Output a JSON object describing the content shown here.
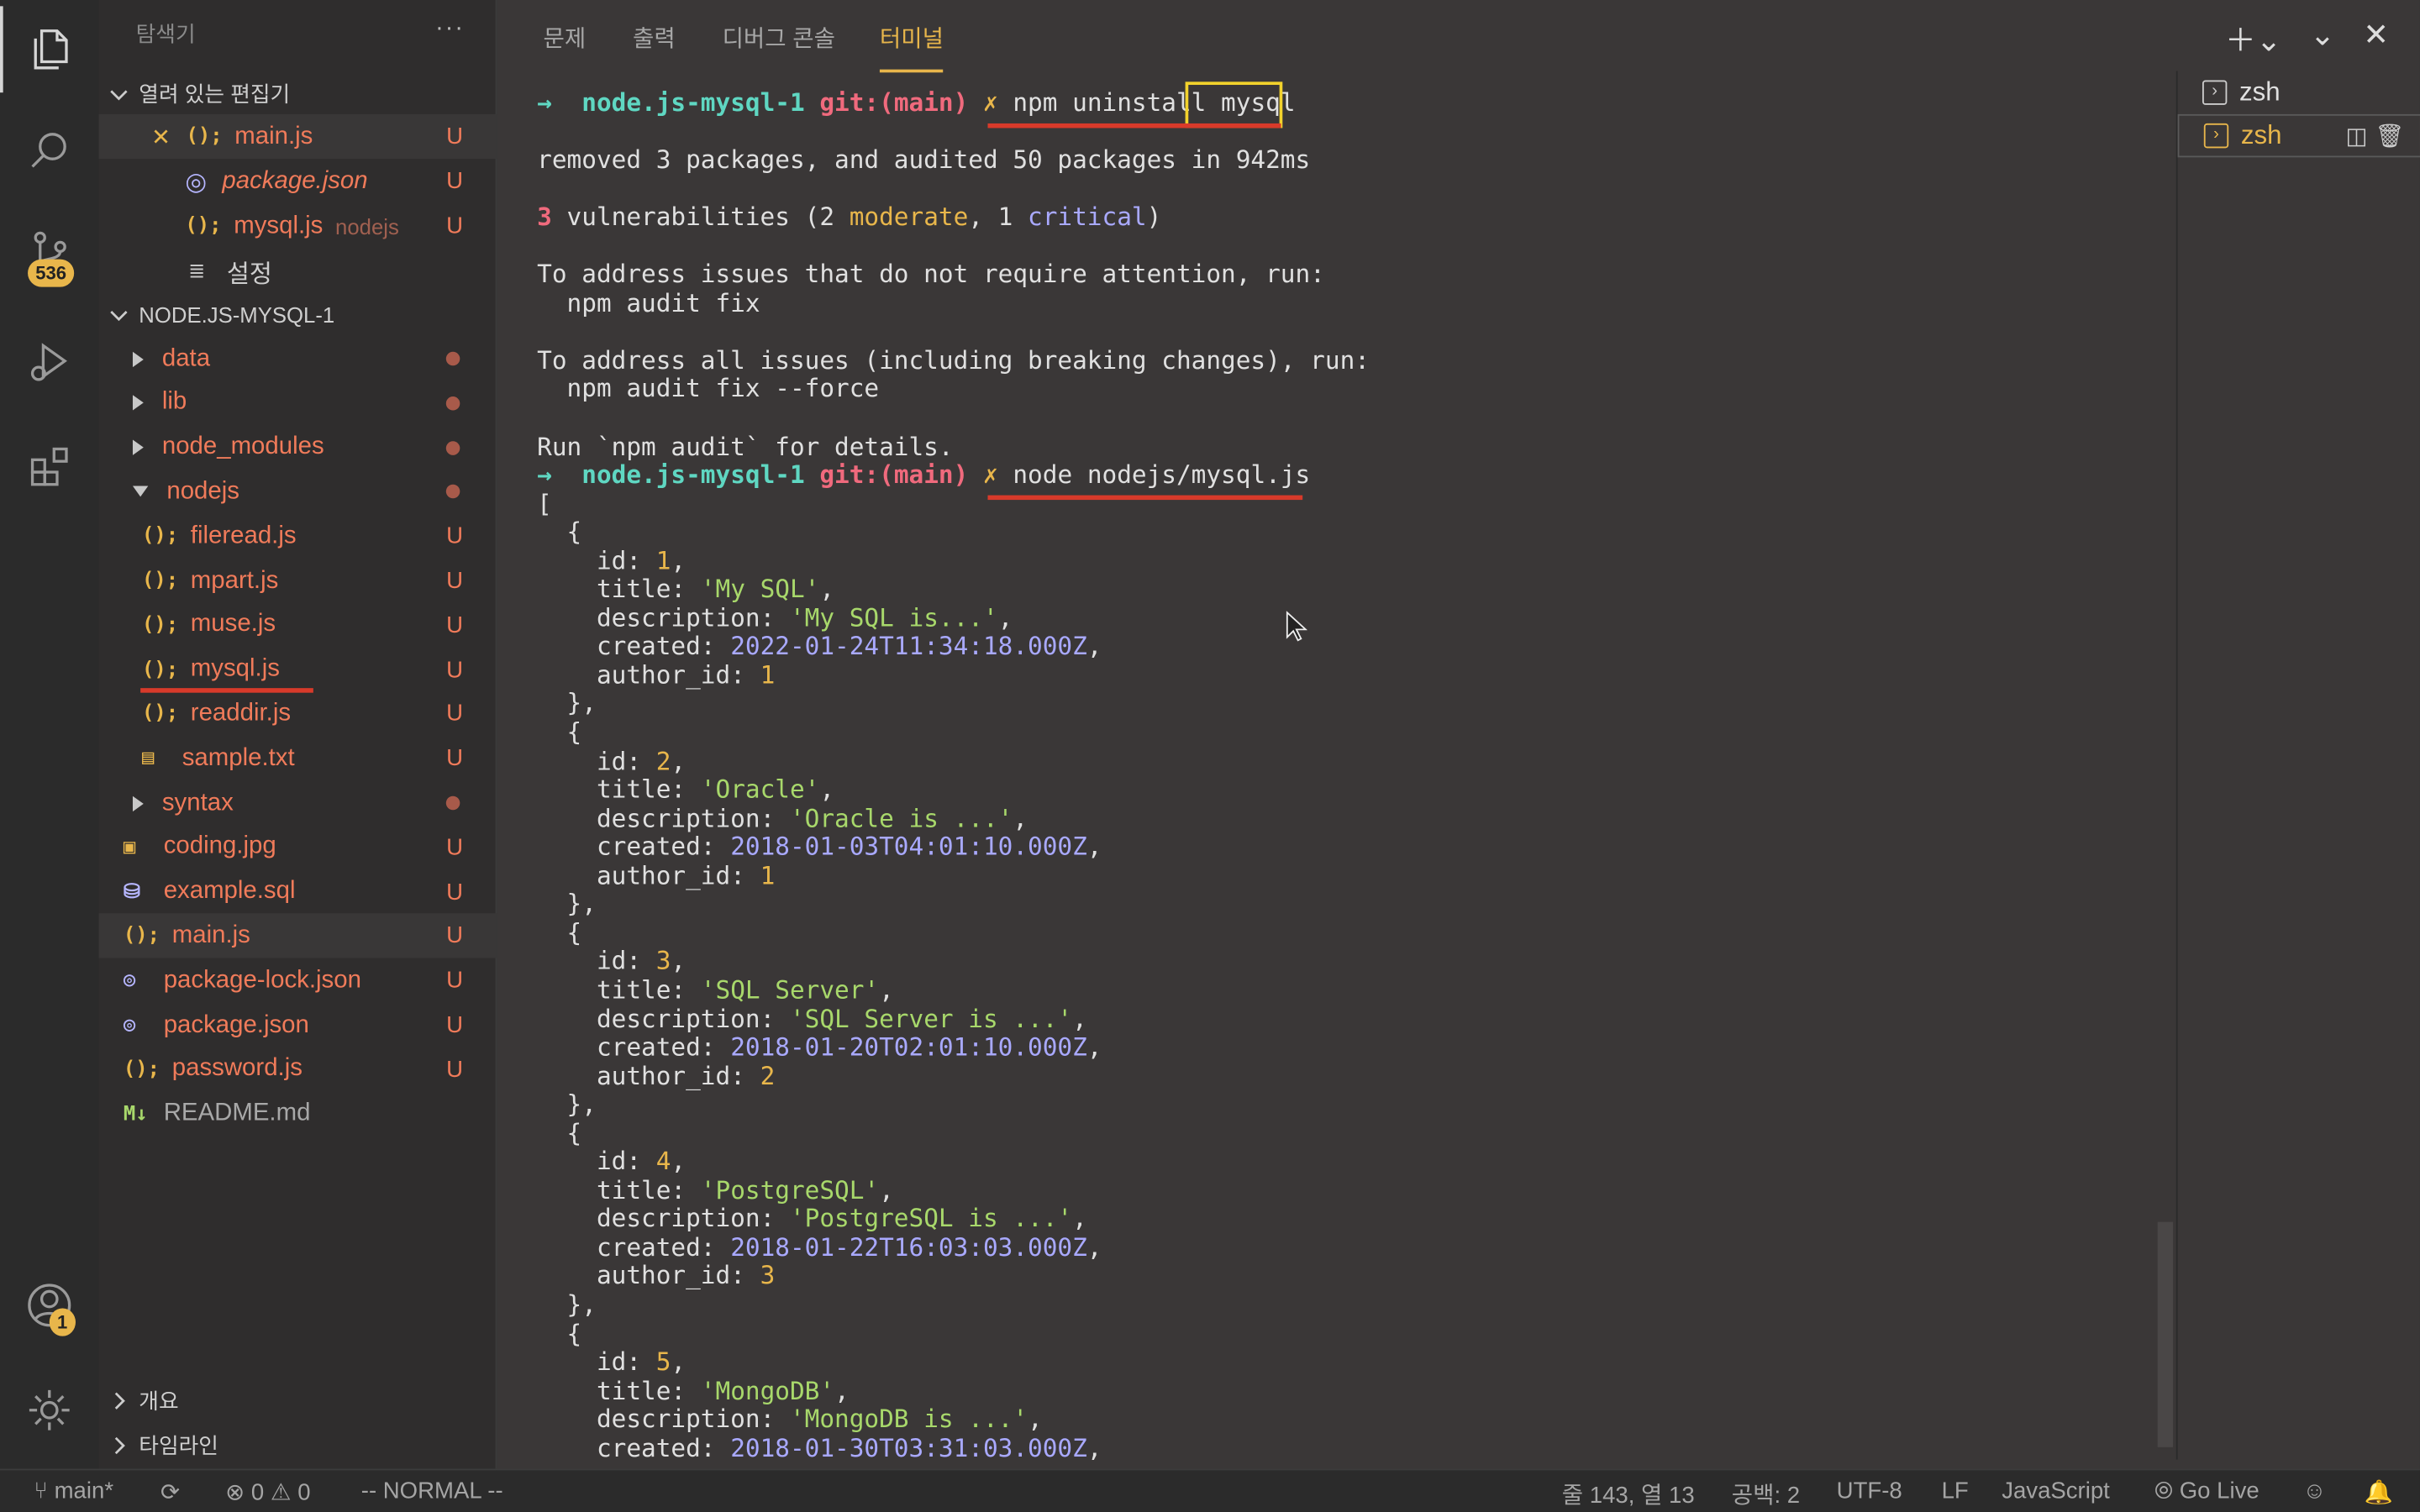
{
  "activity_bar": {
    "scm_badge": "536",
    "account_badge": "1"
  },
  "sidebar": {
    "title": "탐색기",
    "more": "···",
    "open_editors_label": "열려 있는 편집기",
    "open_editors": [
      {
        "name": "main.js",
        "status": "U"
      },
      {
        "name": "package.json",
        "status": "U"
      },
      {
        "name": "mysql.js",
        "hint": "nodejs",
        "status": "U"
      },
      {
        "name": "설정"
      }
    ],
    "project_label": "NODE.JS-MYSQL-1",
    "tree": [
      {
        "name": "data"
      },
      {
        "name": "lib"
      },
      {
        "name": "node_modules"
      },
      {
        "name": "nodejs"
      },
      {
        "name": "fileread.js",
        "status": "U"
      },
      {
        "name": "mpart.js",
        "status": "U"
      },
      {
        "name": "muse.js",
        "status": "U"
      },
      {
        "name": "mysql.js",
        "status": "U"
      },
      {
        "name": "readdir.js",
        "status": "U"
      },
      {
        "name": "sample.txt",
        "status": "U"
      },
      {
        "name": "syntax"
      },
      {
        "name": "coding.jpg",
        "status": "U"
      },
      {
        "name": "example.sql",
        "status": "U"
      },
      {
        "name": "main.js",
        "status": "U"
      },
      {
        "name": "package-lock.json",
        "status": "U"
      },
      {
        "name": "package.json",
        "status": "U"
      },
      {
        "name": "password.js",
        "status": "U"
      },
      {
        "name": "README.md"
      }
    ],
    "outline_label": "개요",
    "timeline_label": "타임라인"
  },
  "panel": {
    "tabs": [
      "문제",
      "출력",
      "디버그 콘솔",
      "터미널"
    ],
    "active_tab": "터미널",
    "terminals": [
      "zsh",
      "zsh"
    ],
    "lines": [
      {
        "segs": [
          [
            "→  ",
            "g"
          ],
          [
            "node.js-mysql-1 ",
            "g"
          ],
          [
            "git:(",
            "pk"
          ],
          [
            "main",
            "pk"
          ],
          [
            ") ",
            "pk"
          ],
          [
            "✗ ",
            "y"
          ],
          [
            "npm uninstall ",
            ""
          ],
          [
            "mysql",
            ""
          ]
        ]
      },
      {
        "segs": [
          [
            "",
            ""
          ]
        ]
      },
      {
        "segs": [
          [
            "removed 3 packages, and audited 50 packages in 942ms",
            ""
          ]
        ]
      },
      {
        "segs": [
          [
            "",
            ""
          ]
        ]
      },
      {
        "segs": [
          [
            "3 ",
            "pk"
          ],
          [
            "vulnerabilities (2 ",
            ""
          ],
          [
            "moderate",
            "y"
          ],
          [
            ", 1 ",
            ""
          ],
          [
            "critical",
            "pu"
          ],
          [
            ")",
            ""
          ]
        ]
      },
      {
        "segs": [
          [
            "",
            ""
          ]
        ]
      },
      {
        "segs": [
          [
            "To address issues that do not require attention, run:",
            ""
          ]
        ]
      },
      {
        "segs": [
          [
            "  npm audit fix",
            ""
          ]
        ]
      },
      {
        "segs": [
          [
            "",
            ""
          ]
        ]
      },
      {
        "segs": [
          [
            "To address all issues (including breaking changes), run:",
            ""
          ]
        ]
      },
      {
        "segs": [
          [
            "  npm audit fix --force",
            ""
          ]
        ]
      },
      {
        "segs": [
          [
            "",
            ""
          ]
        ]
      },
      {
        "segs": [
          [
            "Run `npm audit` for details.",
            ""
          ]
        ]
      },
      {
        "segs": [
          [
            "→  ",
            "g"
          ],
          [
            "node.js-mysql-1 ",
            "g"
          ],
          [
            "git:(",
            "pk"
          ],
          [
            "main",
            "pk"
          ],
          [
            ") ",
            "pk"
          ],
          [
            "✗ ",
            "y"
          ],
          [
            "node nodejs/mysql.js",
            ""
          ]
        ]
      },
      {
        "segs": [
          [
            "[",
            ""
          ]
        ]
      },
      {
        "segs": [
          [
            "  {",
            ""
          ]
        ]
      },
      {
        "segs": [
          [
            "    id: ",
            ""
          ],
          [
            "1",
            "num"
          ],
          [
            ",",
            ""
          ]
        ]
      },
      {
        "segs": [
          [
            "    title: ",
            ""
          ],
          [
            "'My SQL'",
            "gr"
          ],
          [
            ",",
            ""
          ]
        ]
      },
      {
        "segs": [
          [
            "    description: ",
            ""
          ],
          [
            "'My SQL is...'",
            "gr"
          ],
          [
            ",",
            ""
          ]
        ]
      },
      {
        "segs": [
          [
            "    created: ",
            ""
          ],
          [
            "2022-01-24T11:34:18.000Z",
            "pu"
          ],
          [
            ",",
            ""
          ]
        ]
      },
      {
        "segs": [
          [
            "    author_id: ",
            ""
          ],
          [
            "1",
            "num"
          ]
        ]
      },
      {
        "segs": [
          [
            "  },",
            ""
          ]
        ]
      },
      {
        "segs": [
          [
            "  {",
            ""
          ]
        ]
      },
      {
        "segs": [
          [
            "    id: ",
            ""
          ],
          [
            "2",
            "num"
          ],
          [
            ",",
            ""
          ]
        ]
      },
      {
        "segs": [
          [
            "    title: ",
            ""
          ],
          [
            "'Oracle'",
            "gr"
          ],
          [
            ",",
            ""
          ]
        ]
      },
      {
        "segs": [
          [
            "    description: ",
            ""
          ],
          [
            "'Oracle is ...'",
            "gr"
          ],
          [
            ",",
            ""
          ]
        ]
      },
      {
        "segs": [
          [
            "    created: ",
            ""
          ],
          [
            "2018-01-03T04:01:10.000Z",
            "pu"
          ],
          [
            ",",
            ""
          ]
        ]
      },
      {
        "segs": [
          [
            "    author_id: ",
            ""
          ],
          [
            "1",
            "num"
          ]
        ]
      },
      {
        "segs": [
          [
            "  },",
            ""
          ]
        ]
      },
      {
        "segs": [
          [
            "  {",
            ""
          ]
        ]
      },
      {
        "segs": [
          [
            "    id: ",
            ""
          ],
          [
            "3",
            "num"
          ],
          [
            ",",
            ""
          ]
        ]
      },
      {
        "segs": [
          [
            "    title: ",
            ""
          ],
          [
            "'SQL Server'",
            "gr"
          ],
          [
            ",",
            ""
          ]
        ]
      },
      {
        "segs": [
          [
            "    description: ",
            ""
          ],
          [
            "'SQL Server is ...'",
            "gr"
          ],
          [
            ",",
            ""
          ]
        ]
      },
      {
        "segs": [
          [
            "    created: ",
            ""
          ],
          [
            "2018-01-20T02:01:10.000Z",
            "pu"
          ],
          [
            ",",
            ""
          ]
        ]
      },
      {
        "segs": [
          [
            "    author_id: ",
            ""
          ],
          [
            "2",
            "num"
          ]
        ]
      },
      {
        "segs": [
          [
            "  },",
            ""
          ]
        ]
      },
      {
        "segs": [
          [
            "  {",
            ""
          ]
        ]
      },
      {
        "segs": [
          [
            "    id: ",
            ""
          ],
          [
            "4",
            "num"
          ],
          [
            ",",
            ""
          ]
        ]
      },
      {
        "segs": [
          [
            "    title: ",
            ""
          ],
          [
            "'PostgreSQL'",
            "gr"
          ],
          [
            ",",
            ""
          ]
        ]
      },
      {
        "segs": [
          [
            "    description: ",
            ""
          ],
          [
            "'PostgreSQL is ...'",
            "gr"
          ],
          [
            ",",
            ""
          ]
        ]
      },
      {
        "segs": [
          [
            "    created: ",
            ""
          ],
          [
            "2018-01-22T16:03:03.000Z",
            "pu"
          ],
          [
            ",",
            ""
          ]
        ]
      },
      {
        "segs": [
          [
            "    author_id: ",
            ""
          ],
          [
            "3",
            "num"
          ]
        ]
      },
      {
        "segs": [
          [
            "  },",
            ""
          ]
        ]
      },
      {
        "segs": [
          [
            "  {",
            ""
          ]
        ]
      },
      {
        "segs": [
          [
            "    id: ",
            ""
          ],
          [
            "5",
            "num"
          ],
          [
            ",",
            ""
          ]
        ]
      },
      {
        "segs": [
          [
            "    title: ",
            ""
          ],
          [
            "'MongoDB'",
            "gr"
          ],
          [
            ",",
            ""
          ]
        ]
      },
      {
        "segs": [
          [
            "    description: ",
            ""
          ],
          [
            "'MongoDB is ...'",
            "gr"
          ],
          [
            ",",
            ""
          ]
        ]
      },
      {
        "segs": [
          [
            "    created: ",
            ""
          ],
          [
            "2018-01-30T03:31:03.000Z",
            "pu"
          ],
          [
            ",",
            ""
          ]
        ]
      }
    ]
  },
  "status": {
    "branch": "main*",
    "errors": "0",
    "warnings": "0",
    "mode": "-- NORMAL --",
    "position": "줄 143, 열 13",
    "spaces": "공백: 2",
    "encoding": "UTF-8",
    "eol": "LF",
    "language": "JavaScript",
    "golive": "Go Live"
  },
  "colors": {
    "accent": "#e8b64b",
    "untracked": "#f07b5a",
    "highlight": "#f2d22c",
    "underline": "#d83a2a"
  }
}
